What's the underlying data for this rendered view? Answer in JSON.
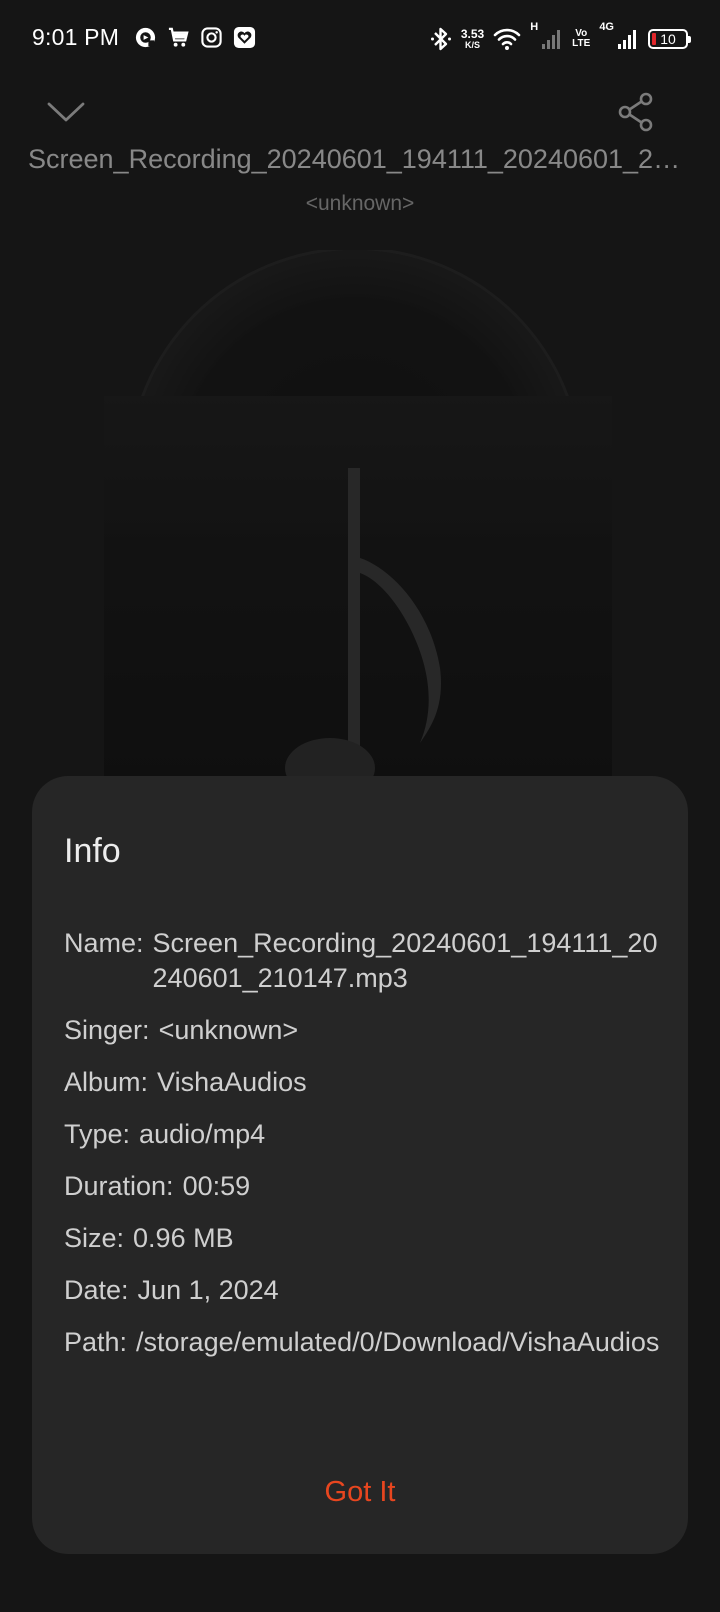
{
  "status_bar": {
    "time": "9:01 PM",
    "left_icons": [
      "screen-recorder-icon",
      "shopping-cart-icon",
      "instagram-icon",
      "heart-app-icon"
    ],
    "net_speed_value": "3.53",
    "net_speed_unit": "K/S",
    "network_h": "H",
    "volte_top": "Vo",
    "volte_bottom": "LTE",
    "network_4g": "4G",
    "battery": "10",
    "battery_color": "#e0262a"
  },
  "player": {
    "title": "Screen_Recording_20240601_194111_20240601_210147.mp3",
    "artist": "<unknown>"
  },
  "dialog": {
    "title": "Info",
    "rows": [
      {
        "label": "Name:",
        "value": "Screen_Recording_20240601_194111_20240601_210147.mp3"
      },
      {
        "label": "Singer:",
        "value": "<unknown>"
      },
      {
        "label": "Album:",
        "value": "VishaAudios"
      },
      {
        "label": "Type:",
        "value": "audio/mp4"
      },
      {
        "label": "Duration:",
        "value": "00:59"
      },
      {
        "label": "Size:",
        "value": "0.96 MB"
      },
      {
        "label": "Date:",
        "value": "Jun 1, 2024"
      },
      {
        "label": "Path:",
        "value": "/storage/emulated/0/Download/VishaAudios"
      }
    ],
    "confirm_label": "Got It",
    "accent_color": "#e8461f"
  }
}
